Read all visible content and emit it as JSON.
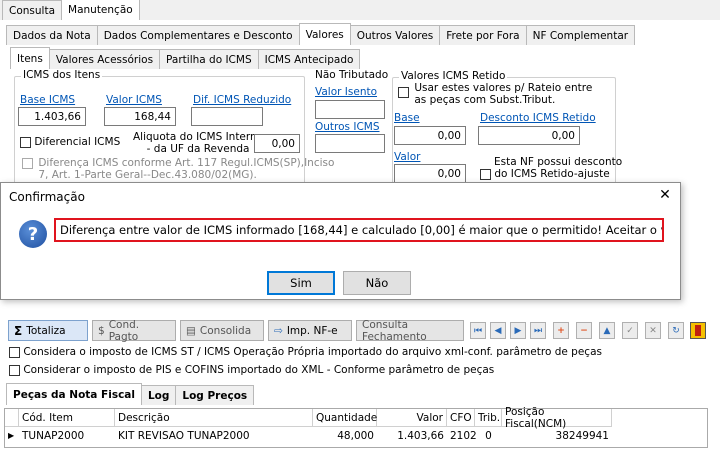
{
  "top_tabs": [
    "Consulta",
    "Manutenção"
  ],
  "sub_tabs": [
    "Dados da Nota",
    "Dados Complementares e Desconto",
    "Valores",
    "Outros Valores",
    "Frete por Fora",
    "NF Complementar"
  ],
  "inner_tabs": [
    "Itens",
    "Valores Acessórios",
    "Partilha do ICMS",
    "ICMS Antecipado"
  ],
  "icms_itens": {
    "title": "ICMS dos Itens",
    "base_label": "Base ICMS",
    "base_value": "1.403,66",
    "valor_label": "Valor ICMS",
    "valor_value": "168,44",
    "dif_label": "Dif. ICMS Reduzido",
    "dif_value": "",
    "diferencial_label": "Diferencial ICMS",
    "aliquota_line1": "Aliquota do ICMS Interna",
    "aliquota_line2": "- da UF da Revenda",
    "aliquota_value": "0,00",
    "diferenca_line1": "Diferença ICMS conforme Art. 117 Regul.ICMS(SP),Inciso",
    "diferenca_line2": "7, Art. 1-Parte Geral--Dec.43.080/02(MG)."
  },
  "nao_tributado": {
    "title": "Não Tributado",
    "valor_isento_label": "Valor Isento",
    "outros_icms_label": "Outros ICMS"
  },
  "icms_retido": {
    "title": "Valores ICMS Retido",
    "usar_line1": "Usar estes valores p/ Rateio  entre",
    "usar_line2": "as peças com Subst.Tribut.",
    "base_label": "Base",
    "base_value": "0,00",
    "desconto_label": "Desconto ICMS Retido",
    "desconto_value": "0,00",
    "valor_label": "Valor",
    "valor_value": "0,00",
    "esta_line1": "Esta NF possui desconto",
    "esta_line2": "do ICMS Retido-ajuste"
  },
  "dialog": {
    "title": "Confirmação",
    "message": "Diferença entre valor de ICMS informado [168,44] e calculado [0,00] é maior que o permitido! Aceitar o valor informado?",
    "yes": "Sim",
    "no": "Não"
  },
  "toolbar": {
    "totaliza": "Totaliza",
    "cond_pagto": "Cond. Pagto",
    "consolida": "Consolida",
    "imp_nfe": "Imp. NF-e",
    "consulta_fechamento": "Consulta Fechamento"
  },
  "options": [
    "Considera o imposto de ICMS ST / ICMS Operação Própria importado do arquivo xml-conf. parâmetro de peças",
    "Considerar o imposto de PIS e COFINS importado do XML - Conforme parâmetro de peças"
  ],
  "bottom_tabs": [
    "Peças da Nota Fiscal",
    "Log",
    "Log Preços"
  ],
  "grid": {
    "headers": [
      "Cód. Item",
      "Descrição",
      "Quantidade",
      "Valor",
      "CFO",
      "Trib.",
      "Posição Fiscal(NCM)"
    ],
    "rows": [
      [
        "TUNAP2000",
        "KIT REVISAO TUNAP2000",
        "48,000",
        "1.403,66",
        "2102",
        "0",
        "38249941"
      ]
    ]
  },
  "colors": {
    "accent_red": "#e0141e",
    "link_blue": "#0055b5",
    "selection": "#dbe7f7"
  }
}
